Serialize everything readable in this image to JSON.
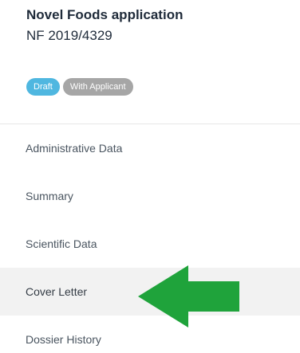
{
  "app": {
    "title": "Novel Foods application",
    "reference": "NF 2019/4329"
  },
  "badges": {
    "draft": "Draft",
    "applicant": "With Applicant"
  },
  "nav": {
    "items": [
      {
        "label": "Administrative Data"
      },
      {
        "label": "Summary"
      },
      {
        "label": "Scientific Data"
      },
      {
        "label": "Cover Letter"
      },
      {
        "label": "Dossier History"
      }
    ],
    "active_index": 3
  },
  "annotation": {
    "arrow_icon": "green-left-arrow-icon",
    "arrow_color": "#1fa33b"
  },
  "colors": {
    "badge_draft": "#4fb7e0",
    "badge_applicant": "#a6a6a6",
    "active_row": "#f2f2f2"
  }
}
